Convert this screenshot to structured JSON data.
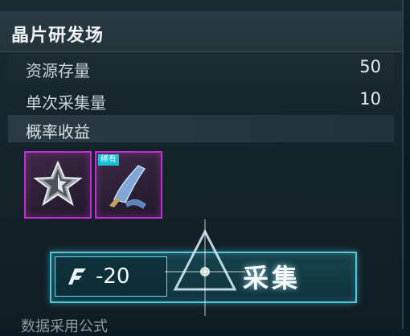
{
  "panel": {
    "title": "晶片研发场",
    "stats": [
      {
        "label": "资源存量",
        "value": "50"
      },
      {
        "label": "单次采集量",
        "value": "10"
      }
    ],
    "section_label": "概率收益",
    "rewards": [
      {
        "icon": "silver-star-icon",
        "tag": ""
      },
      {
        "icon": "cloth-scarf-icon",
        "tag": "稀有"
      }
    ]
  },
  "collect_button": {
    "cost": "-20",
    "label": "采集",
    "cost_icon": "energy-icon"
  },
  "footer": {
    "text": "数据采用公式"
  },
  "colors": {
    "rarity_border": "#c22dd2",
    "button_border": "#4fc7d9",
    "tag_bg": "#16c0d6"
  }
}
